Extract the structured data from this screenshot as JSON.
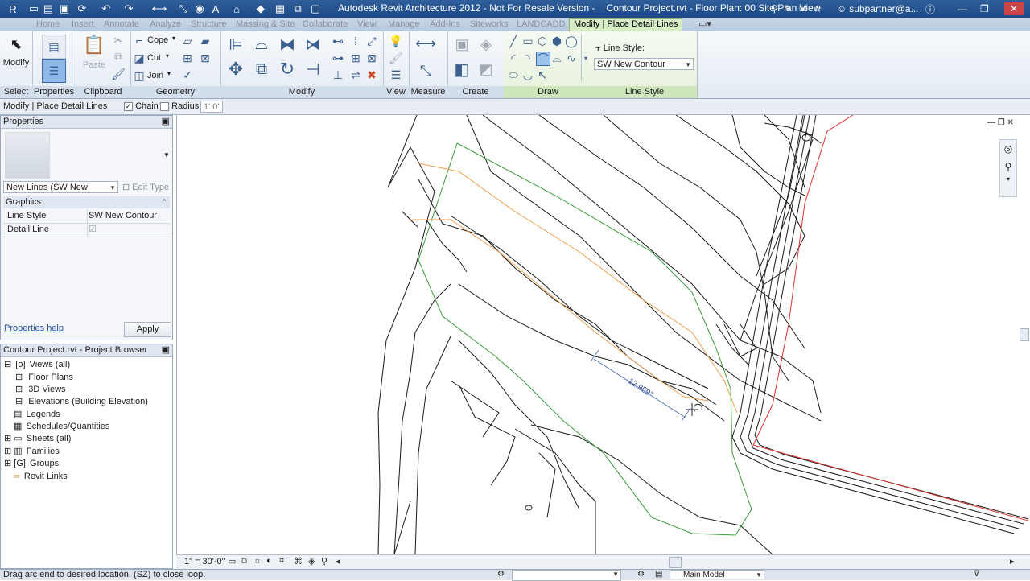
{
  "titlebar": {
    "app_title": "Autodesk Revit Architecture 2012 - Not For Resale Version -",
    "file_title": "Contour Project.rvt - Floor Plan: 00 Site Plan View",
    "user": "subpartner@a..."
  },
  "tabs": [
    "Home",
    "Insert",
    "Annotate",
    "Analyze",
    "Structure",
    "Massing & Site",
    "Collaborate",
    "View",
    "Manage",
    "Add-Ins",
    "Siteworks",
    "LANDCADD",
    "Modify | Place Detail Lines"
  ],
  "ribbon": {
    "select": {
      "modify_label": "Modify",
      "panel": "Select"
    },
    "properties": {
      "panel": "Properties"
    },
    "clipboard": {
      "paste_label": "Paste",
      "panel": "Clipboard"
    },
    "geometry": {
      "cope": "Cope",
      "cut": "Cut",
      "join": "Join",
      "panel": "Geometry"
    },
    "modify": {
      "panel": "Modify"
    },
    "view": {
      "panel": "View"
    },
    "measure": {
      "panel": "Measure"
    },
    "create": {
      "panel": "Create"
    },
    "draw": {
      "panel": "Draw"
    },
    "line_style": {
      "label": "Line Style:",
      "value": "SW New Contour",
      "panel": "Line Style"
    }
  },
  "options_bar": {
    "context": "Modify | Place Detail Lines",
    "chain_label": "Chain",
    "chain_checked": true,
    "radius_label": "Radius:",
    "radius_value": "1'  0\""
  },
  "properties": {
    "header": "Properties",
    "type_selector": "New Lines (SW New Contou",
    "edit_type": "Edit Type",
    "group": "Graphics",
    "rows": [
      {
        "name": "Line Style",
        "value": "SW New Contour"
      },
      {
        "name": "Detail Line",
        "value": "☑"
      }
    ],
    "help_link": "Properties help",
    "apply": "Apply"
  },
  "browser": {
    "header": "Contour Project.rvt - Project Browser",
    "items": [
      {
        "label": "Views (all)",
        "level": 0,
        "toggle": "⊟"
      },
      {
        "label": "Floor Plans",
        "level": 1,
        "toggle": "⊞"
      },
      {
        "label": "3D Views",
        "level": 1,
        "toggle": "⊞"
      },
      {
        "label": "Elevations (Building Elevation)",
        "level": 1,
        "toggle": "⊞"
      },
      {
        "label": "Legends",
        "level": 0,
        "toggle": ""
      },
      {
        "label": "Schedules/Quantities",
        "level": 0,
        "toggle": ""
      },
      {
        "label": "Sheets (all)",
        "level": 0,
        "toggle": "⊞"
      },
      {
        "label": "Families",
        "level": 0,
        "toggle": "⊞"
      },
      {
        "label": "Groups",
        "level": 0,
        "toggle": "⊞"
      },
      {
        "label": "Revit Links",
        "level": 0,
        "toggle": ""
      }
    ]
  },
  "canvas": {
    "dimension_text": "12.959°"
  },
  "viewbar": {
    "scale": "1\" = 30'-0\""
  },
  "statusbar": {
    "message": "Drag arc end to desired location. (SZ) to close loop.",
    "model": "Main Model"
  },
  "colors": {
    "contour_black": "#1a1a1a",
    "contour_orange": "#f0a050",
    "boundary_green": "#3a9a3a",
    "property_red": "#e03030",
    "active_tab_green": "#d7ecc7"
  }
}
